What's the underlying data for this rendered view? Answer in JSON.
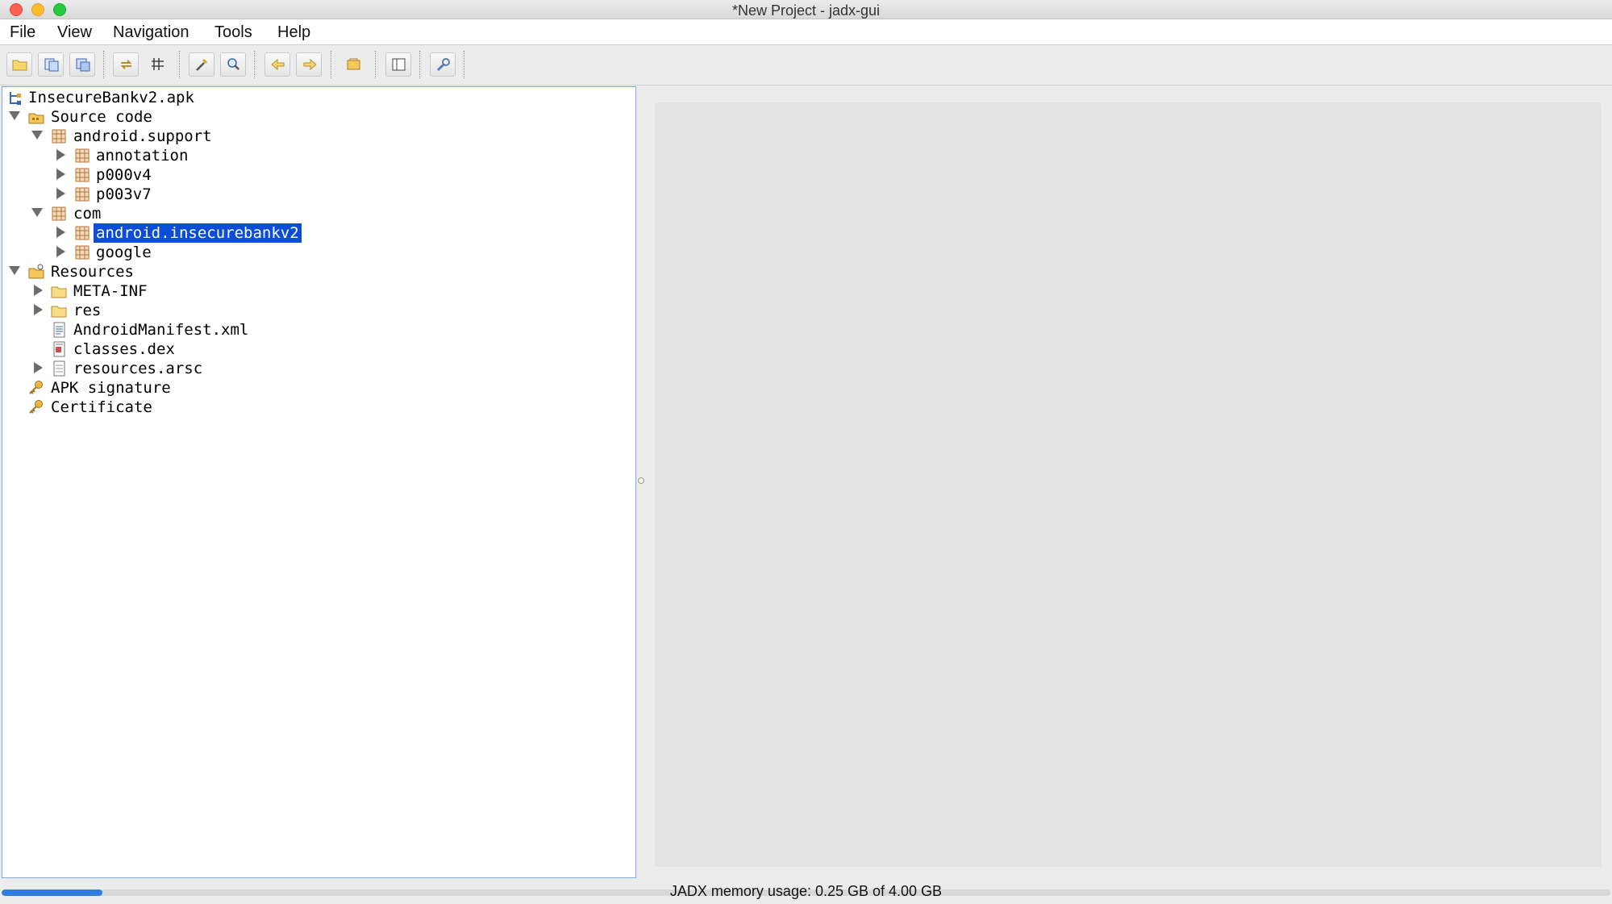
{
  "window": {
    "title": "*New Project - jadx-gui"
  },
  "menu": [
    "File",
    "View",
    "Navigation",
    "Tools",
    "Help"
  ],
  "toolbar": [
    "open-file-icon",
    "add-files-icon",
    "save-all-icon",
    "sync-icon",
    "flatten-packages-icon",
    "text-search-icon",
    "class-search-icon",
    "back-arrow-icon",
    "forward-arrow-icon",
    "log-viewer-icon",
    "toggle-panel-icon",
    "preferences-icon"
  ],
  "tree": {
    "root": "InsecureBankv2.apk",
    "source_code": "Source code",
    "android_support": "android.support",
    "annotation": "annotation",
    "p000v4": "p000v4",
    "p003v7": "p003v7",
    "com": "com",
    "insecurebankv2": "android.insecurebankv2",
    "google": "google",
    "resources": "Resources",
    "meta_inf": "META-INF",
    "res": "res",
    "manifest": "AndroidManifest.xml",
    "classes_dex": "classes.dex",
    "resources_arsc": "resources.arsc",
    "apk_signature": "APK signature",
    "certificate": "Certificate"
  },
  "status": {
    "memory_text": "JADX memory usage: 0.25 GB of 4.00 GB",
    "memory_used_fraction": 0.0625
  },
  "colors": {
    "selection": "#0b4dd9",
    "progress": "#2f7de1"
  }
}
